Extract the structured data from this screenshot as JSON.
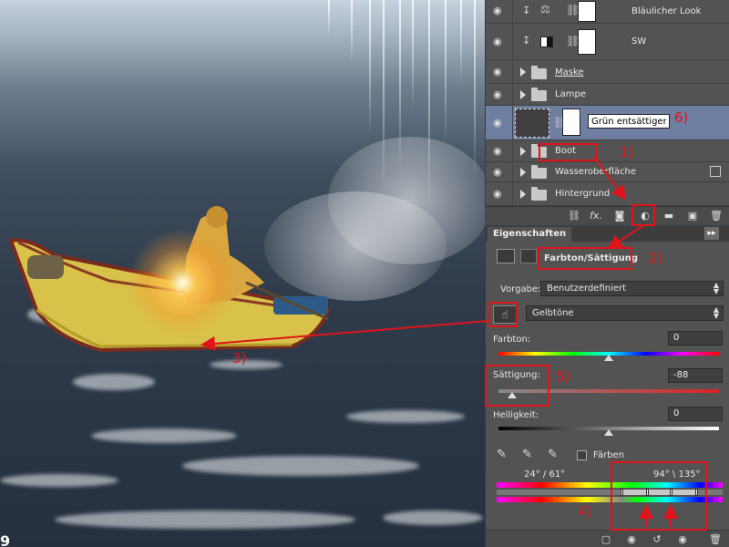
{
  "layers": [
    {
      "name": "Bläulicher Look",
      "kind": "adjustment",
      "icon": "balance-icon",
      "clipped": true,
      "mask": true
    },
    {
      "name": "SW",
      "kind": "adjustment",
      "icon": "black-white-icon",
      "clipped": true,
      "mask": true
    },
    {
      "name": "Maske",
      "kind": "group"
    },
    {
      "name": "Lampe",
      "kind": "group"
    },
    {
      "name": "Grün entsättigen",
      "kind": "adjustment",
      "icon": "hue-saturation-icon",
      "selected": true,
      "editing": true
    },
    {
      "name": "Boot",
      "kind": "group"
    },
    {
      "name": "Wasseroberfläche",
      "kind": "group",
      "smart": true
    },
    {
      "name": "Hintergrund",
      "kind": "group"
    }
  ],
  "layers_toolbar": {
    "icons": [
      "link-icon",
      "fx-icon",
      "mask-icon",
      "adjustment-icon",
      "folder-icon",
      "new-layer-icon",
      "trash-icon"
    ],
    "fx_label": "fx."
  },
  "properties": {
    "tab": "Eigenschaften",
    "collapse": "▸▸",
    "adjustment_title": "Farbton/Sättigung",
    "preset_label": "Vorgabe:",
    "preset_value": "Benutzerdefiniert",
    "range_value": "Gelbtöne",
    "hue_label": "Farbton:",
    "hue_value": "0",
    "saturation_label": "Sättigung:",
    "saturation_value": "-88",
    "lightness_label": "Helligkeit:",
    "lightness_value": "0",
    "colorize_label": "Färben",
    "range_left": "24° / 61°",
    "range_right": "94° \\ 135°",
    "hue_level": 0.5,
    "saturation_level": 0.06,
    "lightness_level": 0.5
  },
  "annotations": [
    "1)",
    "2)",
    "3)",
    "4)",
    "5)",
    "6)"
  ],
  "corner_glyph": "9",
  "colors": {
    "annotation": "#e0141a",
    "selected_layer": "#6e7fa2",
    "panel": "#535353"
  }
}
